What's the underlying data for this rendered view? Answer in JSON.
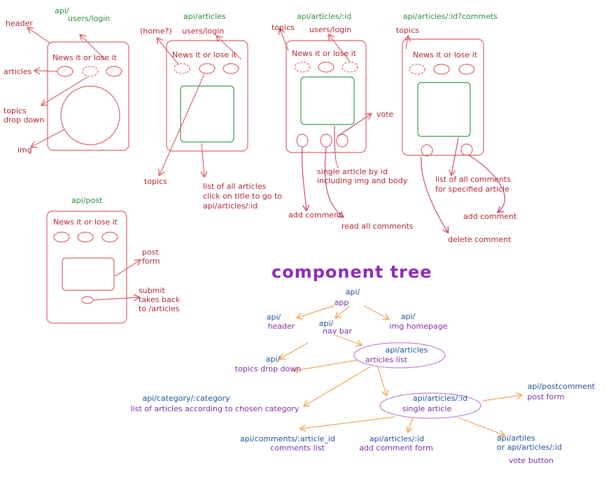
{
  "wireframes": {
    "home": {
      "route": "api/",
      "route2": "users/login",
      "header_label": "header",
      "site_title": "News it or lose it",
      "articles_label": "articles",
      "topics_label": "topics\ndrop down",
      "img_label": "img"
    },
    "articles": {
      "route": "api/articles",
      "home_label": "(home?)",
      "login_label": "users/login",
      "site_title": "News it or lose it",
      "topics_label": "topics",
      "list_label_1": "list of all articles",
      "list_label_2": "click on title to go to",
      "list_label_3": "api/articles/:id"
    },
    "single": {
      "route": "api/articles/:id",
      "topics_label": "topics",
      "login_label": "users/login",
      "site_title": "News it or lose it",
      "vote_label": "vote",
      "single_label_1": "single article by id",
      "single_label_2": "including img and body",
      "add_comment_label": "add comment",
      "read_comments_label": "read all comments"
    },
    "comments": {
      "route": "api/articles/:id?commets",
      "topics_label": "topics",
      "site_title": "News it or lose it",
      "list_label_1": "list of all comments",
      "list_label_2": "for specified article",
      "add_comment_label": "add comment",
      "delete_comment_label": "delete comment"
    },
    "post": {
      "route": "api/post",
      "site_title": "News it or lose it",
      "form_label_1": "post",
      "form_label_2": "form",
      "submit_label_1": "submit",
      "submit_label_2": "takes back",
      "submit_label_3": "to /articles"
    }
  },
  "tree": {
    "title": "component tree",
    "app_route": "api/",
    "app_label": "app",
    "header_route": "api/",
    "header_label": "header",
    "navbar_route": "api/",
    "navbar_label": "nav bar",
    "img_route": "api/",
    "img_label": "img homepage",
    "articles_route": "api/articles",
    "articles_label": "articles list",
    "topics_route": "api/",
    "topics_label": "topics drop down",
    "category_route": "api/category/:category",
    "category_label": "list of articles according to chosen category",
    "single_route": "api/articles/:id",
    "single_label": "single article",
    "postcomment_route": "api/postcomment",
    "postcomment_label": "post form",
    "comments_route": "api/comments/:article_id",
    "comments_label": "comments list",
    "addcomment_route": "api/articles/:id",
    "addcomment_label": "add comment form",
    "vote_route_1": "api/artiles",
    "vote_route_2": "or api/articles/:id",
    "vote_label": "vote button"
  },
  "colors": {
    "wire": "#d9646a",
    "content": "#3a9a4a",
    "label_red": "#b5252f",
    "route_green": "#2e8b3a",
    "route_blue": "#1f4f9c",
    "tree_purple": "#7a2ea6",
    "arrow_orange": "#f0a45a",
    "arrow_pink": "#c7487a"
  }
}
